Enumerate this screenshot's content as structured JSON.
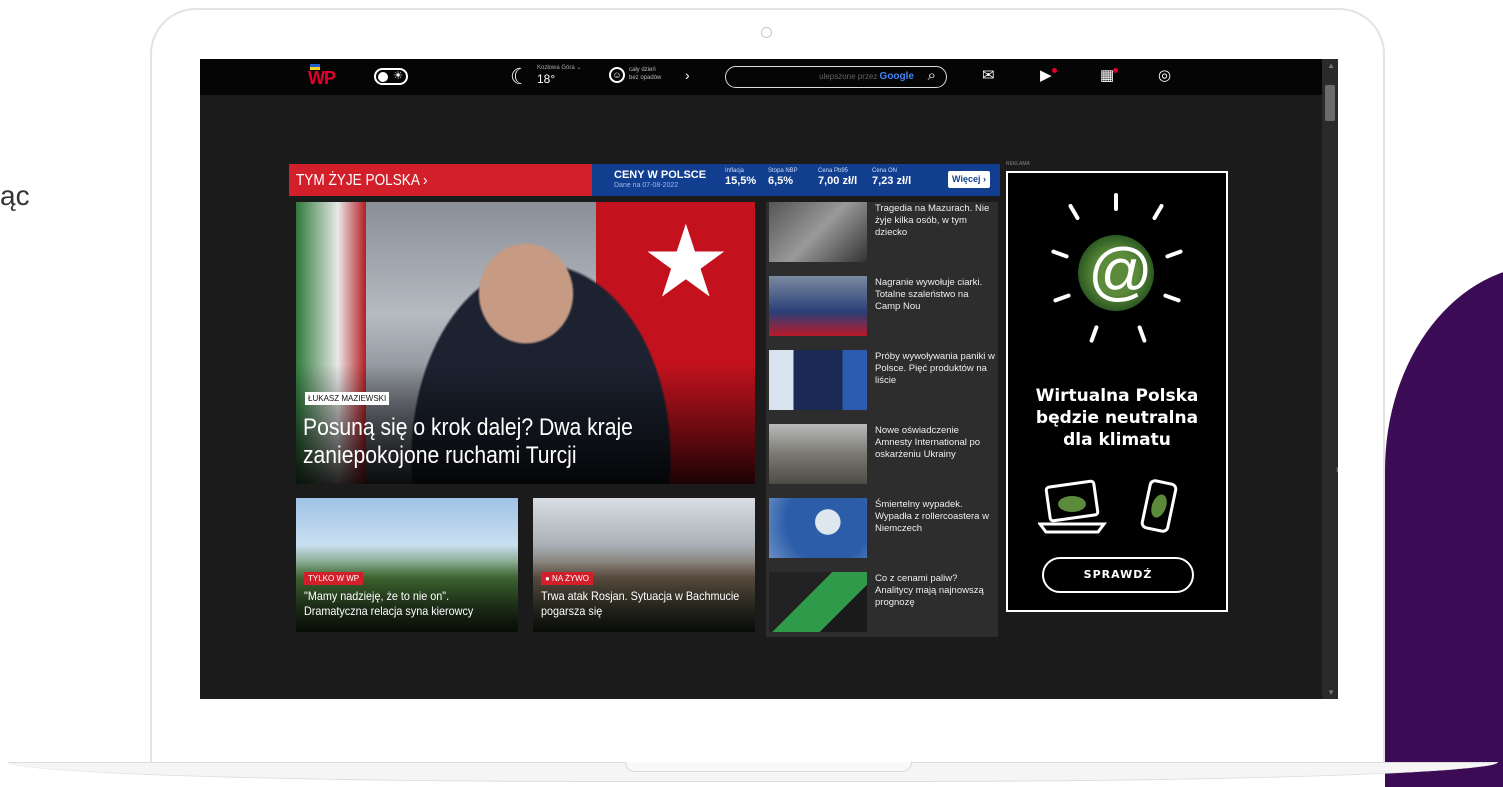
{
  "side_text": "ąc",
  "topbar": {
    "logo": "WP",
    "weather_city": "Kozłowa Góra ⌄",
    "weather_temp": "18°",
    "forecast_line1": "cały dzień",
    "forecast_line2": "bez opadów",
    "search_brand_prefix": "ulepszone przez ",
    "search_brand": "Google"
  },
  "strip": {
    "title": "TYM ŻYJE POLSKA ›",
    "prices_title": "CENY W POLSCE",
    "prices_date": "Dane na 07-08-2022",
    "prices": [
      {
        "label": "Inflacja",
        "value": "15,5%"
      },
      {
        "label": "Stopa NBP",
        "value": "6,5%"
      },
      {
        "label": "Cena Pb95",
        "value": "7,00 zł/l"
      },
      {
        "label": "Cena ON",
        "value": "7,23 zł/l"
      }
    ],
    "more": "Więcej ›"
  },
  "hero": {
    "author": "ŁUKASZ MAZIEWSKI",
    "title": "Posuną się o krok dalej? Dwa kraje zaniepokojone ruchami Turcji"
  },
  "cards": [
    {
      "badge": "TYLKO W WP",
      "title": "\"Mamy nadzieję, że to nie on\". Dramatyczna relacja syna kierowcy"
    },
    {
      "badge": "● NA ŻYWO",
      "title": "Trwa atak Rosjan. Sytuacja w Bachmucie pogarsza się"
    }
  ],
  "news": [
    {
      "text": "Tragedia na Mazurach. Nie żyje kilka osób, w tym dziecko"
    },
    {
      "text": "Nagranie wywołuje ciarki. Totalne szaleństwo na Camp Nou"
    },
    {
      "text": "Próby wywoływania paniki w Polsce. Pięć produktów na liście"
    },
    {
      "text": "Nowe oświadczenie Amnesty International po oskarżeniu Ukrainy"
    },
    {
      "text": "Śmiertelny wypadek. Wypadła z rollercoastera w Niemczech"
    },
    {
      "text": "Co z cenami paliw? Analitycy mają najnowszą prognozę"
    }
  ],
  "ad": {
    "label": "REKLAMA",
    "headline_1": "Wirtualna Polska",
    "headline_2": "będzie neutralna",
    "headline_3": "dla klimatu",
    "button": "SPRAWDŹ"
  },
  "colors": {
    "brand_red": "#d31f2a",
    "prices_blue": "#123e8f",
    "purple_blob": "#3c0b55"
  }
}
